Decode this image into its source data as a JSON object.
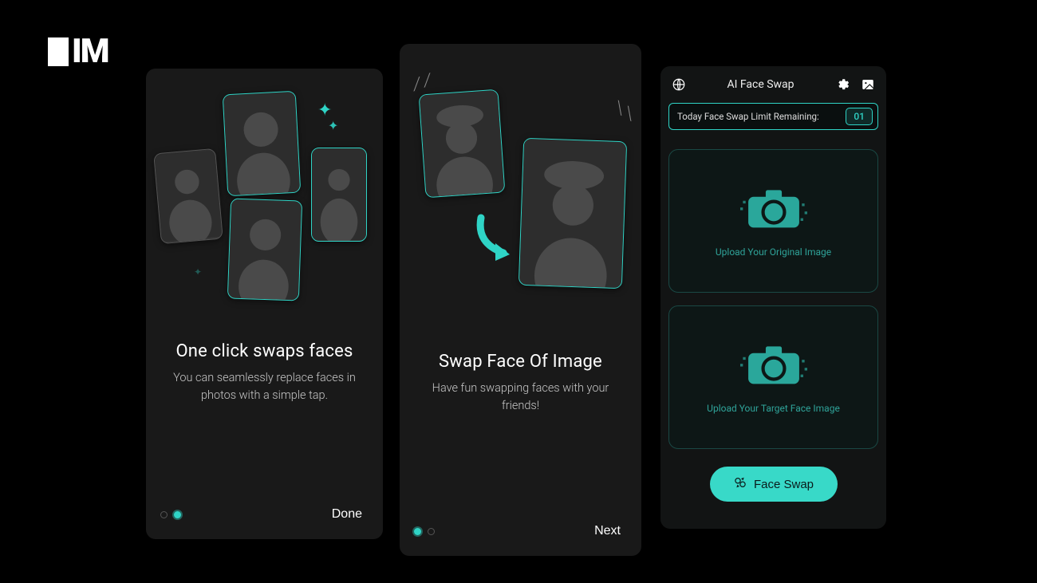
{
  "logo_text": "IM",
  "screens": {
    "one": {
      "title": "One click swaps faces",
      "subtitle": "You can seamlessly replace faces in photos with a simple tap.",
      "action": "Done"
    },
    "two": {
      "title": "Swap Face Of Image",
      "subtitle": "Have fun swapping faces with your friends!",
      "action": "Next"
    },
    "three": {
      "header_title": "AI Face Swap",
      "limit_label": "Today Face Swap Limit Remaining:",
      "limit_value": "01",
      "upload_original": "Upload Your Original Image",
      "upload_target": "Upload Your Target Face Image",
      "swap_button": "Face Swap"
    }
  },
  "icons": {
    "globe": "globe-icon",
    "gear": "gear-icon",
    "gallery": "gallery-icon",
    "camera": "camera-icon",
    "swap": "face-swap-icon",
    "sparkle": "sparkle-icon"
  },
  "colors": {
    "accent": "#2fd4c6",
    "accent_bright": "#38d9c8",
    "bg_phone": "#1a1a1a",
    "bg_page": "#000000"
  }
}
